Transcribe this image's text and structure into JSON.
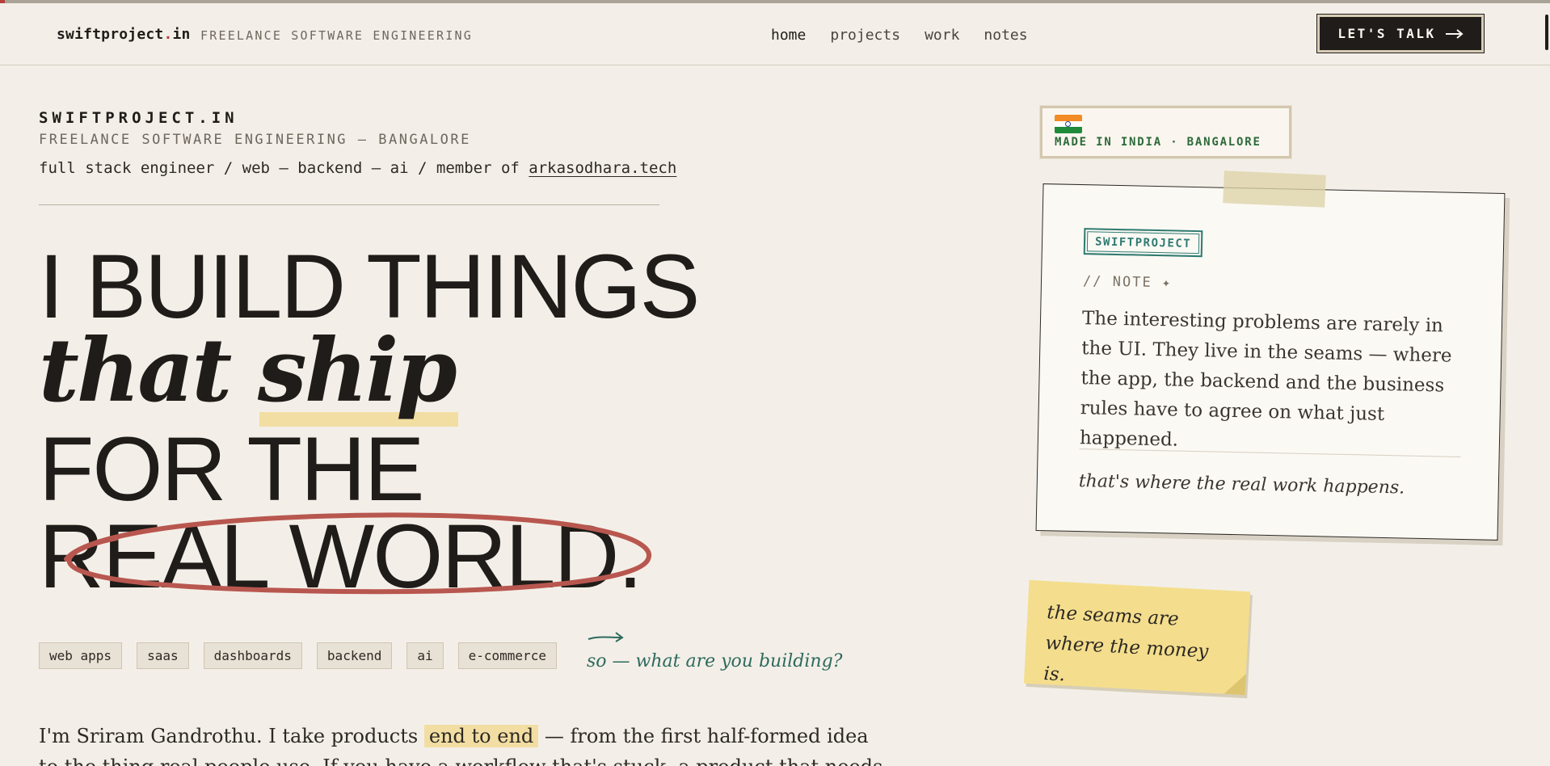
{
  "header": {
    "brand_name": "swiftproject",
    "brand_dot": ".",
    "brand_tld": "in",
    "tagline": "FREELANCE SOFTWARE ENGINEERING",
    "nav": [
      "home",
      "projects",
      "work",
      "notes"
    ],
    "cta_label": "LET'S TALK",
    "cta_icon": "arrow-right-icon"
  },
  "hero": {
    "id": "SWIFTPROJECT.IN",
    "subtitle": "FREELANCE SOFTWARE ENGINEERING — BANGALORE",
    "role": "full stack engineer / web — backend — ai / member of",
    "member_link": "arkasodhara.tech",
    "headline_1": "I BUILD THINGS",
    "headline_2a": "that",
    "headline_2b": "ship",
    "headline_3": "FOR THE",
    "headline_4": "REAL WORLD.",
    "tags": [
      "web apps",
      "saas",
      "dashboards",
      "backend",
      "ai",
      "e-commerce"
    ],
    "ask": "so — what are you building?",
    "intro_before": "I'm Sriram Gandrothu. I take products",
    "intro_highlight": "end to end",
    "intro_after": "— from the first half-formed idea",
    "intro_line2": "to the thing real people use. If you have a workflow that's stuck, a product that needs"
  },
  "badge": {
    "label": "MADE IN INDIA · BANGALORE",
    "flag_icon": "india-flag-icon"
  },
  "card": {
    "stamp": "SWIFTPROJECT",
    "note_label": "// NOTE ✦",
    "quote": "The interesting problems are rarely in the UI. They live in the seams — where the app, the backend and the business rules have to agree on what just happened.",
    "sign": "that's where the real work happens."
  },
  "sticky": {
    "text": "the seams are where the money is."
  },
  "colors": {
    "background": "#f3efe8",
    "ink": "#1f1c19",
    "accent_red": "#b5403a",
    "teal": "#2e7a70",
    "highlight": "#f2dea3",
    "sticky": "#f4de8d"
  }
}
